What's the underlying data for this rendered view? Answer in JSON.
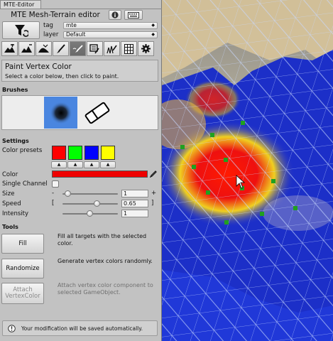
{
  "window": {
    "tab": "MTE-Editor",
    "title": "MTE Mesh-Terrain editor"
  },
  "header": {
    "info_icon": "info-icon",
    "keyboard_icon": "keyboard-icon",
    "filter_icon": "filter-icon",
    "tag_label": "tag",
    "tag_value": "mte",
    "layer_label": "layer",
    "layer_value": "Default"
  },
  "tools": [
    {
      "icon": "raise-terrain-icon",
      "active": false
    },
    {
      "icon": "sculpt-terrain-icon",
      "active": false
    },
    {
      "icon": "smooth-terrain-icon",
      "active": false
    },
    {
      "icon": "paint-brush-icon",
      "active": false
    },
    {
      "icon": "paint-vertex-color-icon",
      "active": true
    },
    {
      "icon": "texture-paint-icon",
      "active": false
    },
    {
      "icon": "grass-painter-icon",
      "active": false
    },
    {
      "icon": "grid-icon",
      "active": false
    },
    {
      "icon": "gear-icon",
      "active": false
    }
  ],
  "info": {
    "title": "Paint Vertex Color",
    "subtitle": "Select a color below, then click to paint."
  },
  "brushes": {
    "label": "Brushes",
    "items": [
      "soft-brush-icon",
      "eraser-icon"
    ]
  },
  "settings": {
    "label": "Settings",
    "color_presets_label": "Color presets",
    "presets": [
      {
        "color": "#ff0000",
        "button": "▲"
      },
      {
        "color": "#00ff00",
        "button": "▲"
      },
      {
        "color": "#0000ff",
        "button": "▲"
      },
      {
        "color": "#ffff00",
        "button": "▲"
      }
    ],
    "color_label": "Color",
    "color_value": "#ee0000",
    "single_channel_label": "Single Channel",
    "single_channel_checked": false,
    "size": {
      "label": "Size",
      "minus": "-",
      "plus": "+",
      "value": "1",
      "fraction": 0.1
    },
    "speed": {
      "label": "Speed",
      "left": "[",
      "right": "]",
      "value": "0.65",
      "fraction": 0.6
    },
    "intensity": {
      "label": "Intensity",
      "value": "1",
      "fraction": 0.45
    }
  },
  "tools_section": {
    "label": "Tools",
    "fill": {
      "label": "Fill",
      "desc": "Fill all targets with the selected color."
    },
    "randomize": {
      "label": "Randomize",
      "desc": "Generate vertex colors randomly."
    },
    "attach": {
      "label_line1": "Attach",
      "label_line2": "VertexColor",
      "desc": "Attach vertex color component to selected GameObject."
    }
  },
  "notice": {
    "icon": "info-icon",
    "text": "Your modification will be saved automatically."
  }
}
